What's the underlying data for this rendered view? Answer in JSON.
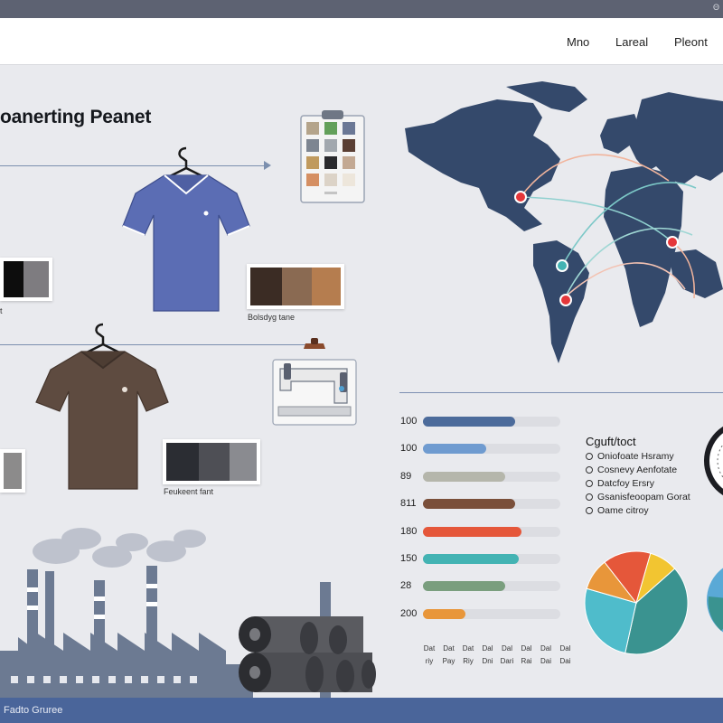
{
  "header": {
    "corner_text": "Θ",
    "nav": [
      "Mno",
      "Lareal",
      "Pleont"
    ]
  },
  "title": "oanerting Peanet",
  "captions": {
    "fabric_top": "Bolsdyg tane",
    "fabric_bottom": "Feukeent fant",
    "left_top": "t"
  },
  "colors": {
    "accent": "#4a659a",
    "map": "#34496b",
    "blue_shirt": "#5b6db4",
    "brown_shirt": "#5e4b40"
  },
  "bars": [
    {
      "label": "100",
      "value": 0.67,
      "color": "#4c6b9b"
    },
    {
      "label": "100",
      "value": 0.46,
      "color": "#6f9bd0"
    },
    {
      "label": "89",
      "value": 0.6,
      "color": "#b5b6ab"
    },
    {
      "label": "811",
      "value": 0.67,
      "color": "#7a4f3a"
    },
    {
      "label": "180",
      "value": 0.72,
      "color": "#e5573a"
    },
    {
      "label": "150",
      "value": 0.7,
      "color": "#43b3b3"
    },
    {
      "label": "28",
      "value": 0.6,
      "color": "#7a9e7e"
    },
    {
      "label": "200",
      "value": 0.31,
      "color": "#e8963a"
    }
  ],
  "bar_axis": [
    [
      "Dat",
      "riy"
    ],
    [
      "Dat",
      "Pay"
    ],
    [
      "Dat",
      "Riy"
    ],
    [
      "Dal",
      "Dni"
    ],
    [
      "Dal",
      "Dari"
    ],
    [
      "Dal",
      "Rai"
    ],
    [
      "Dal",
      "Dai"
    ],
    [
      "Dal",
      "Dai"
    ]
  ],
  "legend": {
    "title": "Cguft/toct",
    "items": [
      "Oniofoate Hsramy",
      "Cosnevy Aenfotate",
      "Datcfoy Ersry",
      "Gsanisfeoopam Gorat",
      "Oame citroy"
    ]
  },
  "pie_data": {
    "type": "pie",
    "slices": [
      {
        "value": 0.09,
        "color": "#f2c531"
      },
      {
        "value": 0.4,
        "color": "#3a9390"
      },
      {
        "value": 0.26,
        "color": "#4fbccb"
      },
      {
        "value": 0.1,
        "color": "#e8963a"
      },
      {
        "value": 0.15,
        "color": "#e5573a"
      }
    ]
  },
  "footer": {
    "text": "Fadto Gruree"
  },
  "icons": [
    "hanger-icon",
    "clipboard-icon",
    "sewing-machine-icon",
    "factory-icon",
    "fabric-roll-icon",
    "world-map-icon",
    "gauge-icon"
  ]
}
